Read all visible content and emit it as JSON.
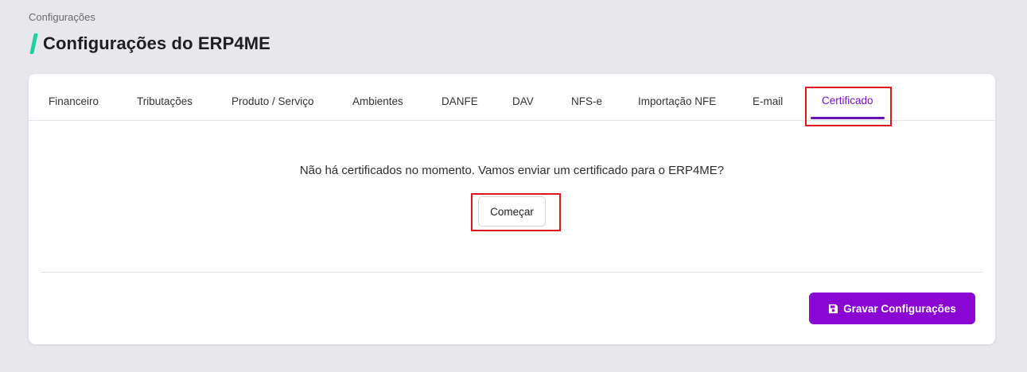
{
  "breadcrumb": "Configurações",
  "page_title": "Configurações do ERP4ME",
  "tabs": [
    {
      "label": "Financeiro"
    },
    {
      "label": "Tributações"
    },
    {
      "label": "Produto / Serviço"
    },
    {
      "label": "Ambientes"
    },
    {
      "label": "DANFE"
    },
    {
      "label": "DAV"
    },
    {
      "label": "NFS-e"
    },
    {
      "label": "Importação NFE"
    },
    {
      "label": "E-mail"
    },
    {
      "label": "Certificado",
      "active": true
    }
  ],
  "certificate": {
    "empty_message": "Não há certificados no momento. Vamos enviar um certificado para o ERP4ME?",
    "start_label": "Começar"
  },
  "footer": {
    "save_label": "Gravar Configurações",
    "save_icon": "floppy-disk-icon"
  },
  "colors": {
    "accent": "#8a06d1",
    "title_accent": "#1fd1a0",
    "highlight": "#e0141e"
  }
}
